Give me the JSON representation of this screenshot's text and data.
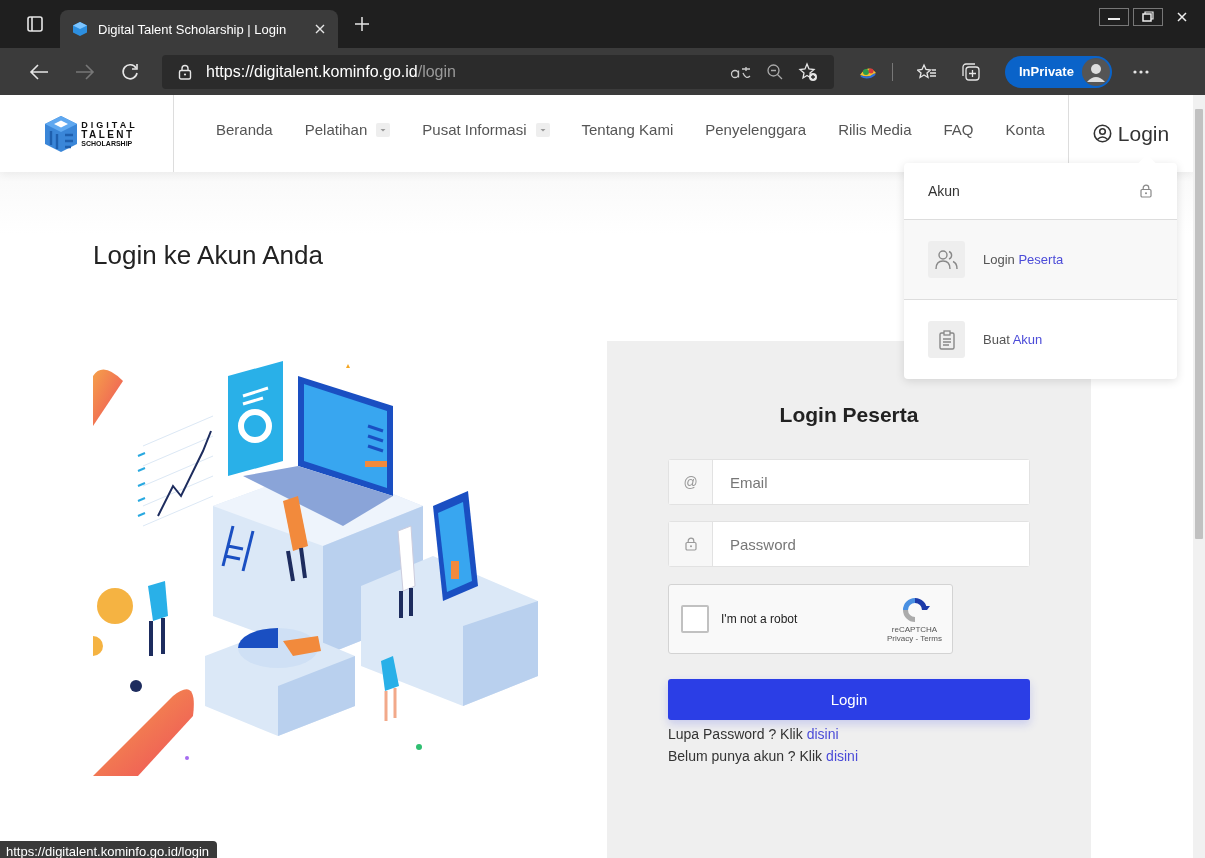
{
  "browser": {
    "tab_title": "Digital Talent Scholarship | Login",
    "url": {
      "scheme": "https://",
      "host": "digitalent.kominfo.go.id",
      "path": "/login"
    },
    "profile_label": "InPrivate"
  },
  "header": {
    "logo_lines": [
      "DIGITAL",
      "TALENT",
      "SCHOLARSHIP"
    ],
    "nav": [
      {
        "label": "Beranda",
        "dropdown": false
      },
      {
        "label": "Pelatihan",
        "dropdown": true
      },
      {
        "label": "Pusat Informasi",
        "dropdown": true
      },
      {
        "label": "Tentang Kami",
        "dropdown": false
      },
      {
        "label": "Penyelenggara",
        "dropdown": false
      },
      {
        "label": "Rilis Media",
        "dropdown": false
      },
      {
        "label": "FAQ",
        "dropdown": false
      },
      {
        "label": "Konta",
        "dropdown": false
      }
    ],
    "login_label": "Login"
  },
  "account_menu": {
    "title": "Akun",
    "items": [
      {
        "kind": "users",
        "label": "Login",
        "link": "Peserta",
        "selected": true
      },
      {
        "kind": "clipboard",
        "label": "Buat",
        "link": "Akun",
        "selected": false
      }
    ]
  },
  "page_title": "Login ke Akun Anda",
  "login_form": {
    "title": "Login Peserta",
    "fields": [
      {
        "kind": "email",
        "addon": "@",
        "placeholder": "Email"
      },
      {
        "kind": "password",
        "placeholder": "Password"
      }
    ],
    "captcha": {
      "label": "I'm not a robot",
      "checked": false,
      "brand": "reCAPTCHA",
      "links": "Privacy - Terms"
    },
    "button": "Login",
    "help": [
      {
        "text": "Lupa Password ? Klik",
        "link": "disini"
      },
      {
        "text": "Belum punya akun ? Klik",
        "link": "disini"
      }
    ]
  },
  "status_url": "https://digitalent.kominfo.go.id/login"
}
